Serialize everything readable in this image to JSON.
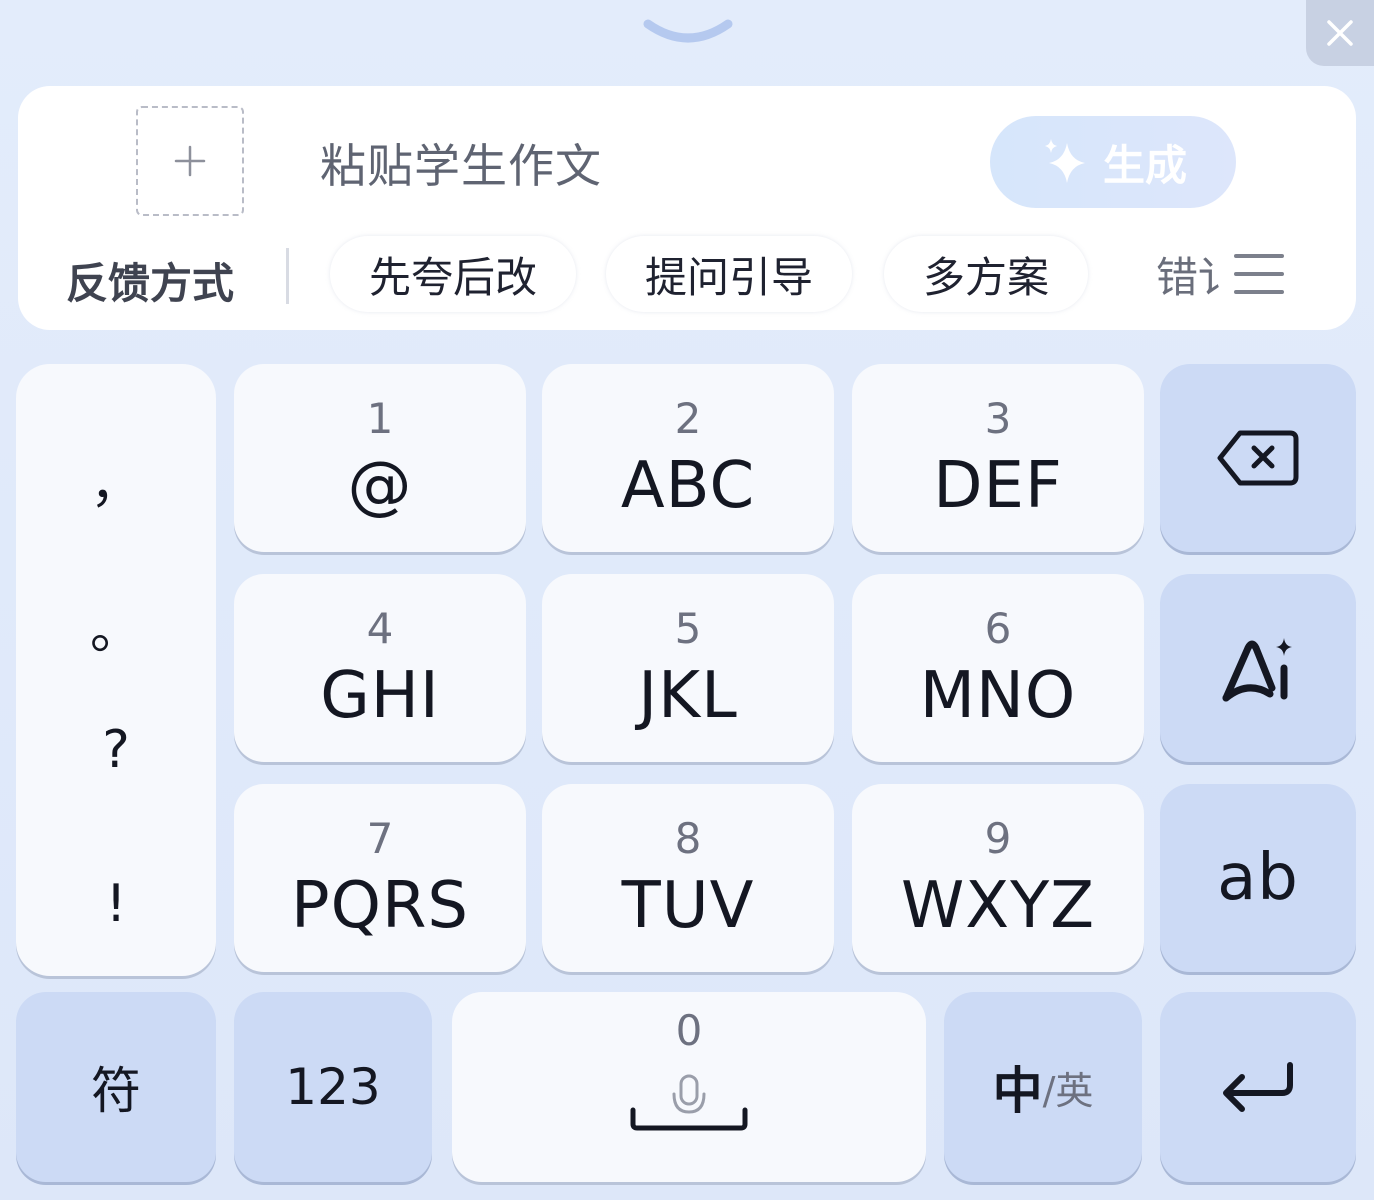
{
  "top": {
    "collapse_icon": "chevron-down-icon",
    "close_icon": "close-icon"
  },
  "panel": {
    "add_icon": "plus-icon",
    "input_placeholder": "粘贴学生作文",
    "generate_label": "生成",
    "generate_icon": "sparkle-icon",
    "chips_title": "反馈方式",
    "chips": [
      "先夸后改",
      "提问引导",
      "多方案",
      "错讠"
    ],
    "menu_icon": "menu-icon"
  },
  "keyboard": {
    "punctuation": [
      "，",
      "。",
      "?",
      "!"
    ],
    "keys": [
      {
        "num": "1",
        "letters": "@"
      },
      {
        "num": "2",
        "letters": "ABC"
      },
      {
        "num": "3",
        "letters": "DEF"
      },
      {
        "num": "4",
        "letters": "GHI"
      },
      {
        "num": "5",
        "letters": "JKL"
      },
      {
        "num": "6",
        "letters": "MNO"
      },
      {
        "num": "7",
        "letters": "PQRS"
      },
      {
        "num": "8",
        "letters": "TUV"
      },
      {
        "num": "9",
        "letters": "WXYZ"
      }
    ],
    "side": {
      "backspace_icon": "backspace-icon",
      "ai_icon": "ai-icon",
      "case_label": "ab"
    },
    "bottom": {
      "symbols_label": "符",
      "numbers_label": "123",
      "space_num": "0",
      "mic_icon": "microphone-icon",
      "lang_main": "中",
      "lang_alt": "/英",
      "enter_icon": "enter-icon"
    }
  },
  "colors": {
    "background": "#e3ecfb",
    "key_light": "#f7f9fd",
    "key_blue": "#ccdaf5",
    "generate_button": "#d6e6fb"
  }
}
